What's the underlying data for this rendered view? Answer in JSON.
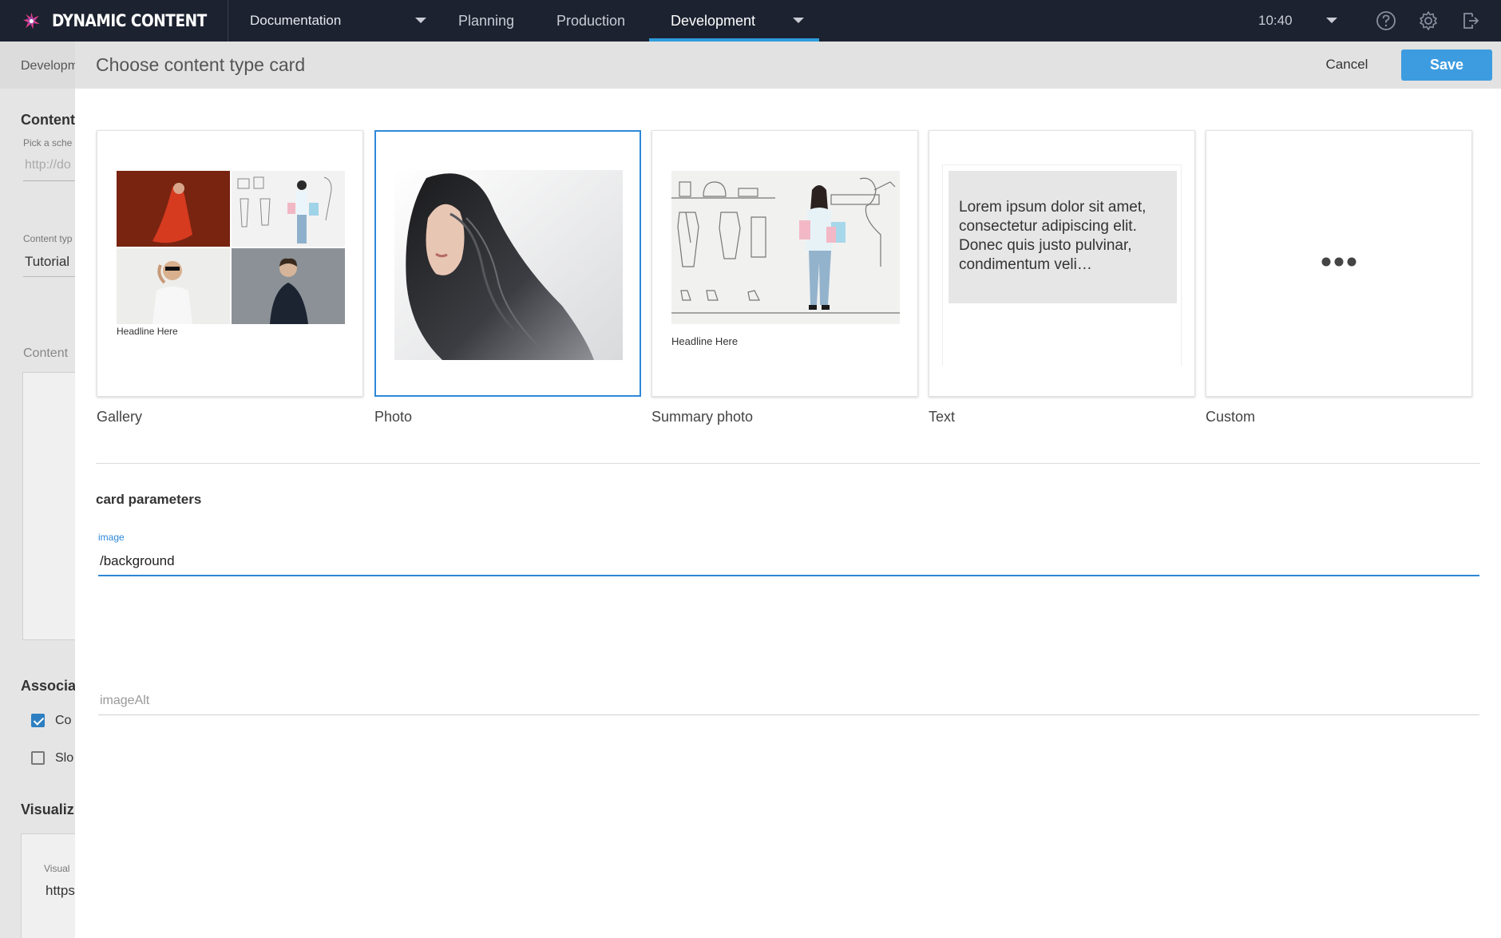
{
  "app": {
    "brand_name": "DYNAMIC CONTENT",
    "hub": "Documentation",
    "nav_tabs": [
      {
        "label": "Planning"
      },
      {
        "label": "Production"
      },
      {
        "label": "Development"
      }
    ],
    "time": "10:40",
    "icons": [
      "help-icon",
      "gear-icon",
      "logout-icon"
    ]
  },
  "background_page": {
    "breadcrumb": "Developm",
    "content_heading": "Content",
    "schema_hint": "Pick a sche",
    "schema_placeholder": "http://do",
    "content_type_label": "Content typ",
    "content_type_value": "Tutorial",
    "content_section": "Content",
    "associated_heading": "Associa",
    "checkbox_1": "Co",
    "checkbox_2": "Slo",
    "visualization_heading": "Visualiz",
    "visual_label": "Visual",
    "visual_value": "https"
  },
  "modal": {
    "title": "Choose content type card",
    "cancel_label": "Cancel",
    "save_label": "Save",
    "cards": [
      {
        "label": "Gallery",
        "caption": "Headline Here",
        "selected": false
      },
      {
        "label": "Photo",
        "selected": true
      },
      {
        "label": "Summary photo",
        "caption": "Headline Here",
        "selected": false
      },
      {
        "label": "Text",
        "preview_text": "Lorem ipsum dolor sit amet, consectetur adipiscing elit. Donec quis justo pulvinar, condimentum veli…",
        "selected": false
      },
      {
        "label": "Custom",
        "selected": false
      }
    ],
    "params": {
      "heading": "card parameters",
      "image_label": "image",
      "image_value": "/background",
      "image_alt_placeholder": "imageAlt"
    }
  },
  "colors": {
    "nav_bg": "#1c2230",
    "accent": "#2d9cdb",
    "save_button": "#3d9ce0",
    "selected_border": "#2d88d8",
    "brand_pink": "#e83e8c"
  }
}
